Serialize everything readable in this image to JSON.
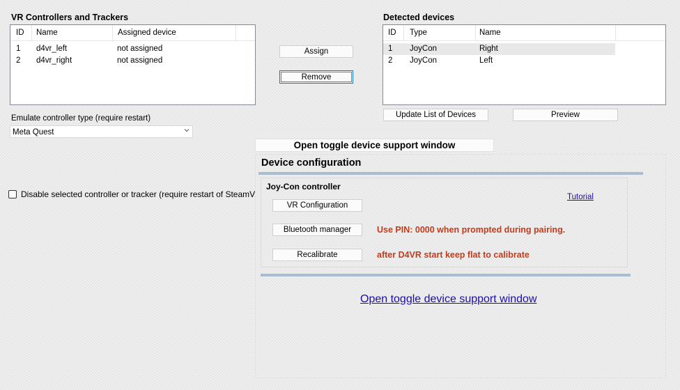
{
  "controllers": {
    "title": "VR Controllers and Trackers",
    "columns": [
      "ID",
      "Name",
      "Assigned device"
    ],
    "rows": [
      {
        "id": "1",
        "name": "d4vr_left",
        "assigned": "not assigned"
      },
      {
        "id": "2",
        "name": "d4vr_right",
        "assigned": "not assigned"
      }
    ]
  },
  "actions": {
    "assign_label": "Assign",
    "remove_label": "Remove"
  },
  "devices": {
    "title": "Detected devices",
    "columns": [
      "ID",
      "Type",
      "Name"
    ],
    "rows": [
      {
        "id": "1",
        "type": "JoyCon",
        "name": "Right"
      },
      {
        "id": "2",
        "type": "JoyCon",
        "name": "Left"
      }
    ],
    "update_label": "Update List of Devices",
    "preview_label": "Preview"
  },
  "emulate": {
    "label": "Emulate controller type (require restart)",
    "selected": "Meta Quest"
  },
  "disable_checkbox_label": "Disable selected controller or tracker (require restart of SteamVR",
  "toggle_button_label": "Open toggle device support window",
  "device_config": {
    "title": "Device configuration",
    "section_title": "Joy-Con controller",
    "tutorial_label": "Tutorial",
    "vr_config_label": "VR Configuration",
    "bluetooth_label": "Bluetooth manager",
    "recalibrate_label": "Recalibrate",
    "pin_hint": "Use PIN: 0000 when prompted during pairing.",
    "calibrate_hint": "after D4VR start keep flat to calibrate",
    "toggle_link_label": "Open toggle device support window"
  },
  "colors": {
    "warning": "#c33c1a",
    "link": "#1a0dab",
    "separator": "#a9bcd0"
  }
}
